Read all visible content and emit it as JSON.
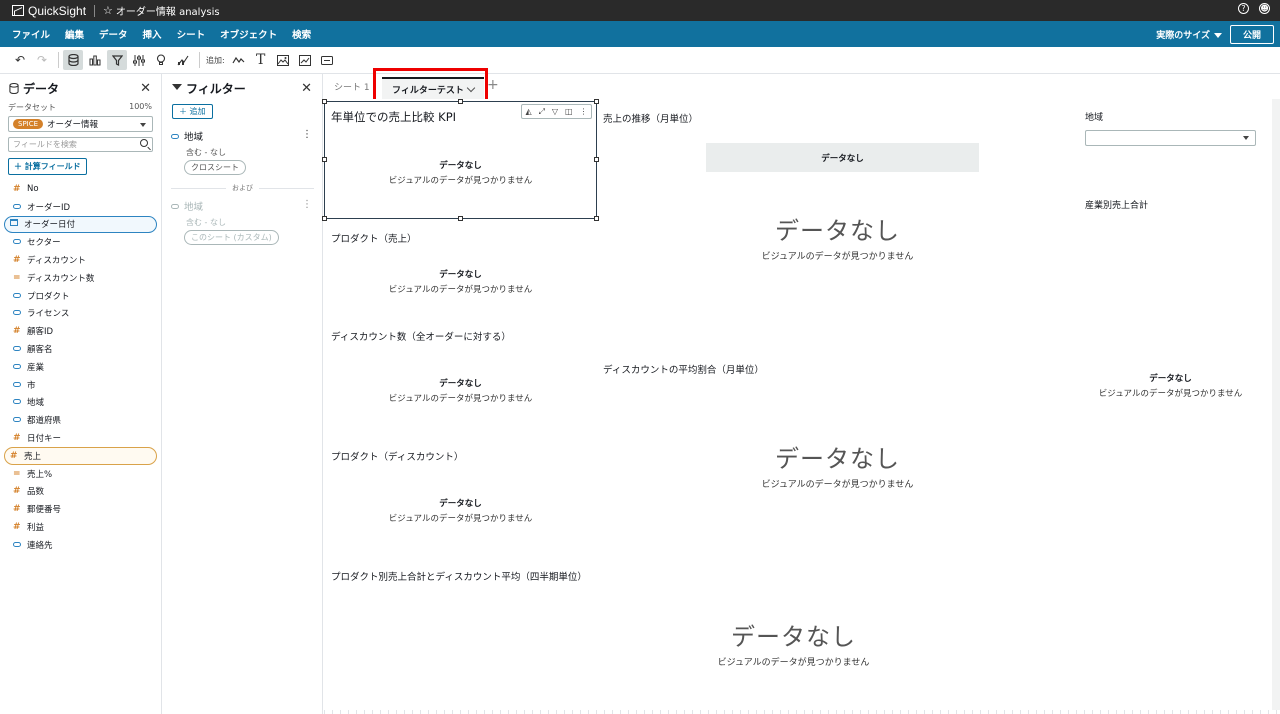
{
  "topbar": {
    "app_name": "QuickSight",
    "analysis_name": "オーダー情報 analysis",
    "help_icon": "?",
    "user_icon": "user-icon"
  },
  "menu": {
    "items": [
      "ファイル",
      "編集",
      "データ",
      "挿入",
      "シート",
      "オブジェクト",
      "検索"
    ],
    "size_label": "実際のサイズ",
    "publish": "公開"
  },
  "toolbar": {
    "add_label": "追加:"
  },
  "data_panel": {
    "title": "データ",
    "dataset_label": "データセット",
    "dataset_pct": "100%",
    "spice": "SPICE",
    "dataset_name": "オーダー情報",
    "search_placeholder": "フィールドを検索",
    "calc_field": "計算フィールド",
    "fields": [
      {
        "name": "No",
        "type": "hash"
      },
      {
        "name": "オーダーID",
        "type": "dim"
      },
      {
        "name": "オーダー日付",
        "type": "date",
        "selected": "blue"
      },
      {
        "name": "セクター",
        "type": "dim"
      },
      {
        "name": "ディスカウント",
        "type": "hash"
      },
      {
        "name": "ディスカウント数",
        "type": "eq"
      },
      {
        "name": "プロダクト",
        "type": "dim"
      },
      {
        "name": "ライセンス",
        "type": "dim"
      },
      {
        "name": "顧客ID",
        "type": "hash"
      },
      {
        "name": "顧客名",
        "type": "dim"
      },
      {
        "name": "産業",
        "type": "dim"
      },
      {
        "name": "市",
        "type": "dim"
      },
      {
        "name": "地域",
        "type": "dim"
      },
      {
        "name": "都道府県",
        "type": "dim"
      },
      {
        "name": "日付キー",
        "type": "hash"
      },
      {
        "name": "売上",
        "type": "hash",
        "selected": "orange"
      },
      {
        "name": "売上%",
        "type": "eq"
      },
      {
        "name": "品数",
        "type": "hash"
      },
      {
        "name": "郵便番号",
        "type": "hash"
      },
      {
        "name": "利益",
        "type": "hash"
      },
      {
        "name": "連絡先",
        "type": "dim"
      }
    ]
  },
  "filter_panel": {
    "title": "フィルター",
    "add": "追加",
    "filters": [
      {
        "name": "地域",
        "sub": "含む - なし",
        "scope": "クロスシート"
      },
      {
        "name": "地域",
        "sub": "含む - なし",
        "scope": "このシート (カスタム)"
      }
    ],
    "and_label": "および"
  },
  "tabs": {
    "sheet1": "シート 1",
    "active": "フィルターテスト"
  },
  "visuals": {
    "kpi_title": "年単位での売上比較 KPI",
    "trend_title": "売上の推移（月単位）",
    "product_sales_title": "プロダクト（売上）",
    "discount_count_title": "ディスカウント数（全オーダーに対する）",
    "avg_discount_title": "ディスカウントの平均割合（月単位）",
    "product_discount_title": "プロダクト（ディスカウント）",
    "quarterly_title": "プロダクト別売上合計とディスカウント平均（四半期単位）",
    "region_label": "地域",
    "industry_title": "産業別売上合計",
    "no_data": "データなし",
    "no_data_sub": "ビジュアルのデータが見つかりません"
  }
}
